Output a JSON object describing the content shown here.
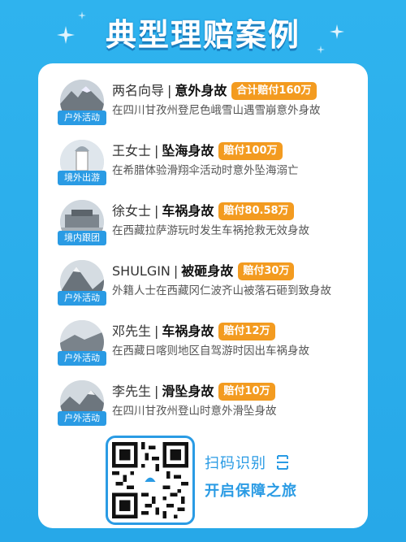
{
  "title": "典型理赔案例",
  "cases": [
    {
      "tag": "户外活动",
      "name": "两名向导",
      "event": "意外身故",
      "badge": "合计赔付160万",
      "desc": "在四川甘孜州登尼色峨雪山遇雪崩意外身故"
    },
    {
      "tag": "境外出游",
      "name": "王女士",
      "event": "坠海身故",
      "badge": "赔付100万",
      "desc": "在希腊体验滑翔伞活动时意外坠海溺亡"
    },
    {
      "tag": "境内跟团",
      "name": "徐女士",
      "event": "车祸身故",
      "badge": "赔付80.58万",
      "desc": "在西藏拉萨游玩时发生车祸抢救无效身故"
    },
    {
      "tag": "户外活动",
      "name": "SHULGIN",
      "event": "被砸身故",
      "badge": "赔付30万",
      "desc": "外籍人士在西藏冈仁波齐山被落石砸到致身故"
    },
    {
      "tag": "户外活动",
      "name": "邓先生",
      "event": "车祸身故",
      "badge": "赔付12万",
      "desc": "在西藏日喀则地区自驾游时因出车祸身故"
    },
    {
      "tag": "户外活动",
      "name": "李先生",
      "event": "滑坠身故",
      "badge": "赔付10万",
      "desc": "在四川甘孜州登山时意外滑坠身故"
    }
  ],
  "separator": "|",
  "qr": {
    "scan_label": "扫码识别",
    "cta_label": "开启保障之旅"
  },
  "colors": {
    "accent": "#2a9be4",
    "badge": "#f39b20",
    "background": "#2fb3ee"
  },
  "icons": {
    "scan": "scan-icon",
    "sparkle": "sparkle-icon"
  }
}
